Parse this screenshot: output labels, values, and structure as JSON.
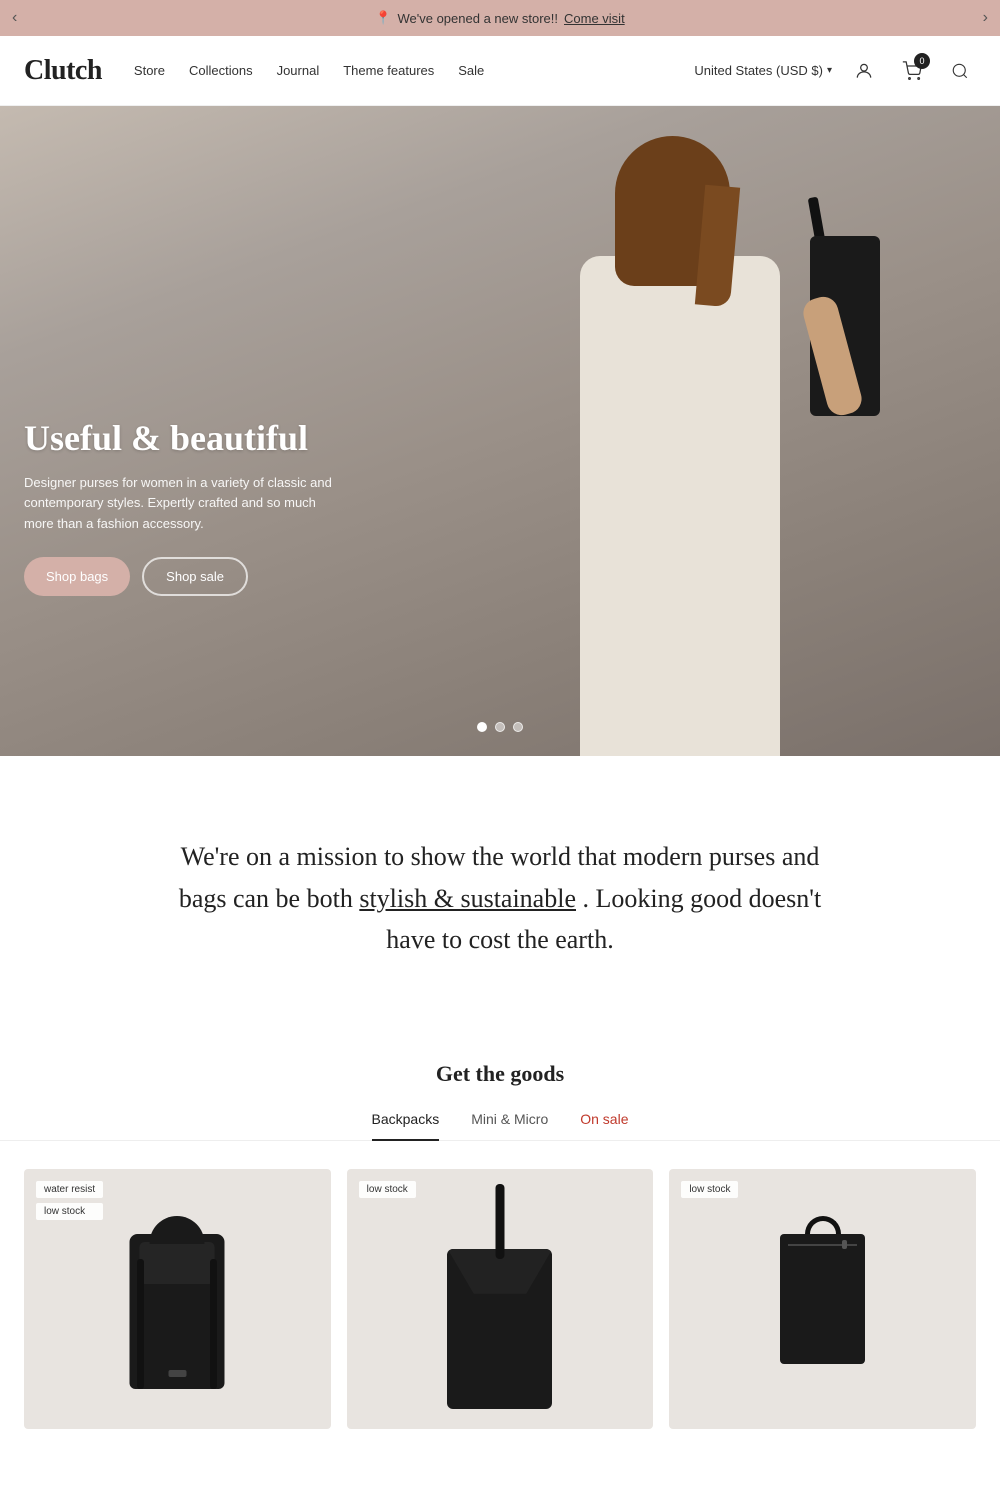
{
  "announcement": {
    "text": "We've opened a new store!!",
    "link_text": "Come visit",
    "prev_label": "‹",
    "next_label": "›"
  },
  "header": {
    "logo": "Clutch",
    "nav": [
      {
        "label": "Store",
        "href": "#"
      },
      {
        "label": "Collections",
        "href": "#"
      },
      {
        "label": "Journal",
        "href": "#"
      },
      {
        "label": "Theme features",
        "href": "#"
      },
      {
        "label": "Sale",
        "href": "#"
      }
    ],
    "currency": "United States (USD $)",
    "cart_count": "0"
  },
  "hero": {
    "title": "Useful & beautiful",
    "description": "Designer purses for women in a variety of classic and contemporary styles. Expertly crafted and so much more than a fashion accessory.",
    "btn_primary": "Shop bags",
    "btn_secondary": "Shop sale",
    "dots": [
      {
        "active": true
      },
      {
        "active": false
      },
      {
        "active": false
      }
    ]
  },
  "mission": {
    "text_before": "We're on a mission to show the world that modern purses and bags can be both",
    "text_link": "stylish & sustainable",
    "text_after": ". Looking good doesn't have to cost the earth."
  },
  "products": {
    "heading": "Get the goods",
    "tabs": [
      {
        "label": "Backpacks",
        "active": true,
        "sale": false
      },
      {
        "label": "Mini & Micro",
        "active": false,
        "sale": false
      },
      {
        "label": "On sale",
        "active": false,
        "sale": true
      }
    ],
    "items": [
      {
        "badges": [
          "water resist",
          "low stock"
        ],
        "alt": "Roll-top backpack"
      },
      {
        "badges": [
          "low stock"
        ],
        "alt": "Tote backpack"
      },
      {
        "badges": [
          "low stock"
        ],
        "alt": "Rectangle bag"
      }
    ]
  }
}
